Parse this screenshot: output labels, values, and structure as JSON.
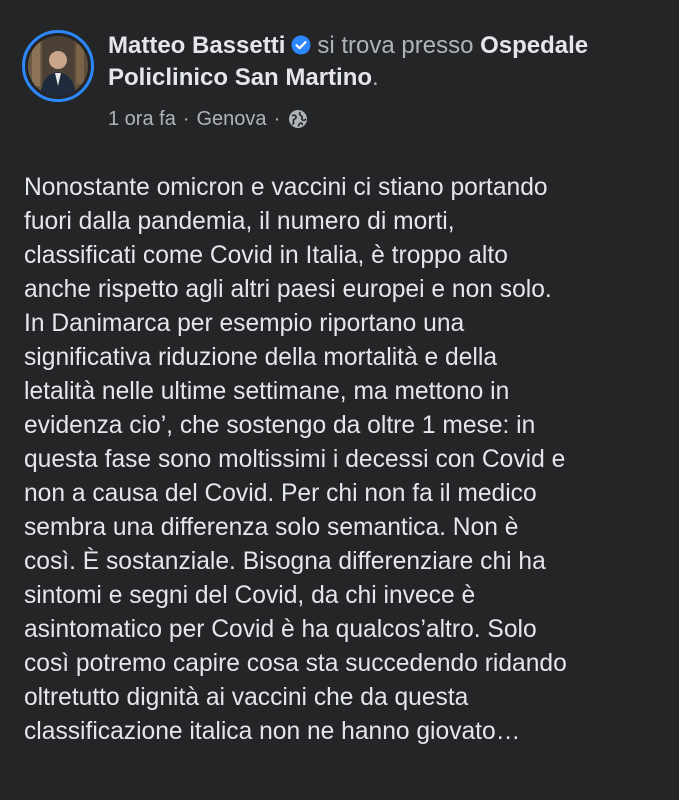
{
  "post": {
    "author": "Matteo Bassetti",
    "checkin_text": "si trova presso",
    "place": "Ospedale Policlinico San Martino",
    "period": ".",
    "time": "1 ora fa",
    "separator": "·",
    "location": "Genova",
    "verified_icon": "verified-badge-icon",
    "privacy_icon": "globe-icon",
    "accent_color": "#2d88ff",
    "body_lines": [
      "Nonostante omicron e vaccini ci stiano portando",
      "fuori dalla pandemia, il numero di morti,",
      "classificati come Covid in Italia, è troppo alto",
      "anche rispetto agli altri paesi europei e non solo.",
      "In Danimarca per esempio riportano una",
      "significativa riduzione della mortalità e della",
      "letalità nelle ultime settimane, ma mettono in",
      "evidenza cio’, che sostengo da oltre 1 mese: in",
      "questa fase sono moltissimi i decessi con Covid e",
      "non a causa del Covid. Per chi non fa il medico",
      "sembra una differenza solo semantica. Non è",
      "così. È sostanziale. Bisogna differenziare chi ha",
      "sintomi e segni del Covid, da chi invece è",
      "asintomatico per Covid è ha qualcos’altro. Solo",
      "così potremo capire cosa sta succedendo ridando",
      "oltretutto dignità ai vaccini che da questa",
      "classificazione italica non ne hanno giovato…"
    ]
  }
}
